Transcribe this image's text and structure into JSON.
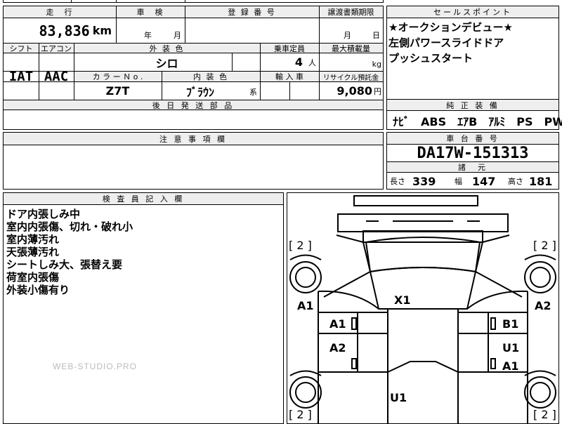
{
  "vehicle_info": {
    "mileage_label": "走　行",
    "mileage_value": "83,836",
    "mileage_unit": "km",
    "inspection_label": "車　検",
    "inspection_year_unit": "年",
    "inspection_month_unit": "月",
    "registration_label": "登 録 番 号",
    "transfer_deadline_label": "譲渡書類期限",
    "transfer_month_unit": "月",
    "transfer_day_unit": "日",
    "shift_label": "シフト",
    "shift_value": "IAT",
    "ac_label": "エアコン",
    "ac_value": "AAC",
    "exterior_color_label": "外 装 色",
    "exterior_color_value": "シロ",
    "capacity_label": "乗車定員",
    "capacity_value": "4",
    "capacity_unit": "人",
    "max_load_label": "最大積載量",
    "max_load_unit": "kg",
    "color_no_label": "カ ラ ー Ｎ o .",
    "color_no_value": "Z7T",
    "interior_color_label": "内 装 色",
    "interior_color_value": "ﾌﾞﾗｳﾝ",
    "interior_color_suffix": "系",
    "import_label": "輸 入 車",
    "recycle_label": "リサイクル預託金",
    "recycle_value": "9,080",
    "recycle_unit": "円",
    "later_parts_label": "後 日 発 送 部 品"
  },
  "sales_point": {
    "label": "セールスポイント",
    "lines": [
      "★オークションデビュー★",
      "左側パワースライドドア",
      "プッシュスタート"
    ]
  },
  "genuine_equipment": {
    "label": "純 正 装 備",
    "value": "ﾅﾋﾞ　ABS　ｴｱB　ｱﾙﾐ　PS　PW"
  },
  "notes": {
    "label": "注 意 事 項 欄"
  },
  "chassis": {
    "label": "車 台 番 号",
    "value": "DA17W-151313"
  },
  "dimensions": {
    "label": "諸　元",
    "length_label": "長さ",
    "length_value": "339",
    "width_label": "幅",
    "width_value": "147",
    "height_label": "高さ",
    "height_value": "181"
  },
  "inspector": {
    "label": "検 査 員 記 入 欄",
    "lines": [
      "ドア内張しみ中",
      "室内内張傷、切れ・破れ小",
      "室内薄汚れ",
      "天張薄汚れ",
      "シートしみ大、張替え要",
      "荷室内張傷",
      "外装小傷有り"
    ]
  },
  "diagram": {
    "brackets": [
      "[ 2 ]",
      "[ 2 ]",
      "[ 2 ]",
      "[ 2 ]"
    ],
    "marks": {
      "x1": "X1",
      "a1_left_outer": "A1",
      "a2_right_outer": "A2",
      "a1_left_door": "A1",
      "b1_right_door": "B1",
      "a2_left_rear": "A2",
      "u1_right_rear": "U1",
      "a1_right_rear": "A1",
      "u1_rear": "U1"
    }
  },
  "watermark": "WEB-STUDIO.PRO"
}
